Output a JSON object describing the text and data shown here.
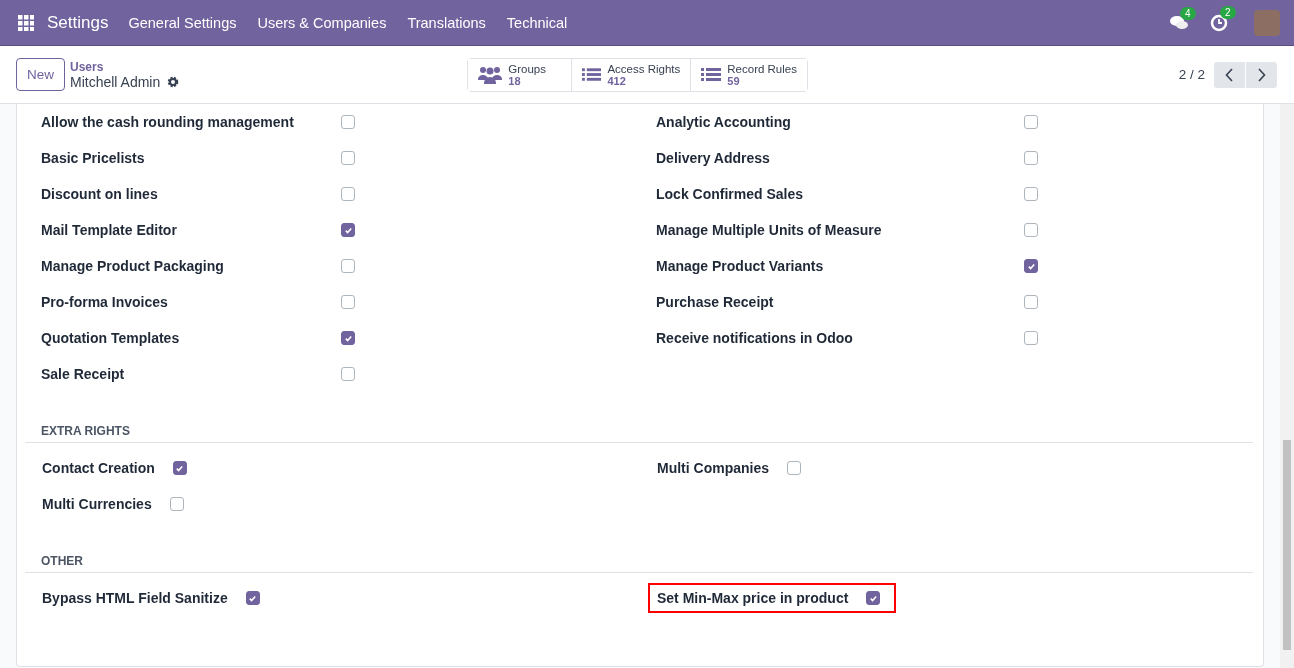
{
  "navbar": {
    "app": "Settings",
    "menu": [
      "General Settings",
      "Users & Companies",
      "Translations",
      "Technical"
    ],
    "messages_badge": "4",
    "activities_badge": "2"
  },
  "control_panel": {
    "new_button": "New",
    "breadcrumb": "Users",
    "record": "Mitchell Admin",
    "stats": [
      {
        "kind": "groups",
        "label": "Groups",
        "value": "18"
      },
      {
        "kind": "list",
        "label": "Access Rights",
        "value": "412"
      },
      {
        "kind": "list",
        "label": "Record Rules",
        "value": "59"
      }
    ],
    "pager": "2 / 2"
  },
  "sections": [
    {
      "kind": "grid",
      "items": [
        {
          "label": "Allow the cash rounding management",
          "checked": false,
          "highlighted": false
        },
        {
          "label": "Analytic Accounting",
          "checked": false,
          "highlighted": false
        },
        {
          "label": "Basic Pricelists",
          "checked": false,
          "highlighted": false
        },
        {
          "label": "Delivery Address",
          "checked": false,
          "highlighted": false
        },
        {
          "label": "Discount on lines",
          "checked": false,
          "highlighted": false
        },
        {
          "label": "Lock Confirmed Sales",
          "checked": false,
          "highlighted": false
        },
        {
          "label": "Mail Template Editor",
          "checked": true,
          "highlighted": false
        },
        {
          "label": "Manage Multiple Units of Measure",
          "checked": false,
          "highlighted": false
        },
        {
          "label": "Manage Product Packaging",
          "checked": false,
          "highlighted": false
        },
        {
          "label": "Manage Product Variants",
          "checked": true,
          "highlighted": false
        },
        {
          "label": "Pro-forma Invoices",
          "checked": false,
          "highlighted": false
        },
        {
          "label": "Purchase Receipt",
          "checked": false,
          "highlighted": false
        },
        {
          "label": "Quotation Templates",
          "checked": true,
          "highlighted": false
        },
        {
          "label": "Receive notifications in Odoo",
          "checked": false,
          "highlighted": false
        },
        {
          "label": "Sale Receipt",
          "checked": false,
          "highlighted": false
        }
      ]
    },
    {
      "kind": "inline",
      "title": "EXTRA RIGHTS",
      "items": [
        {
          "label": "Contact Creation",
          "checked": true
        },
        {
          "label": "Multi Companies",
          "checked": false
        },
        {
          "label": "Multi Currencies",
          "checked": false
        }
      ]
    },
    {
      "kind": "inline",
      "title": "OTHER",
      "items": [
        {
          "label": "Bypass HTML Field Sanitize",
          "checked": true,
          "highlighted": false
        },
        {
          "label": "Set Min-Max price in product",
          "checked": true,
          "highlighted": true
        }
      ]
    }
  ]
}
